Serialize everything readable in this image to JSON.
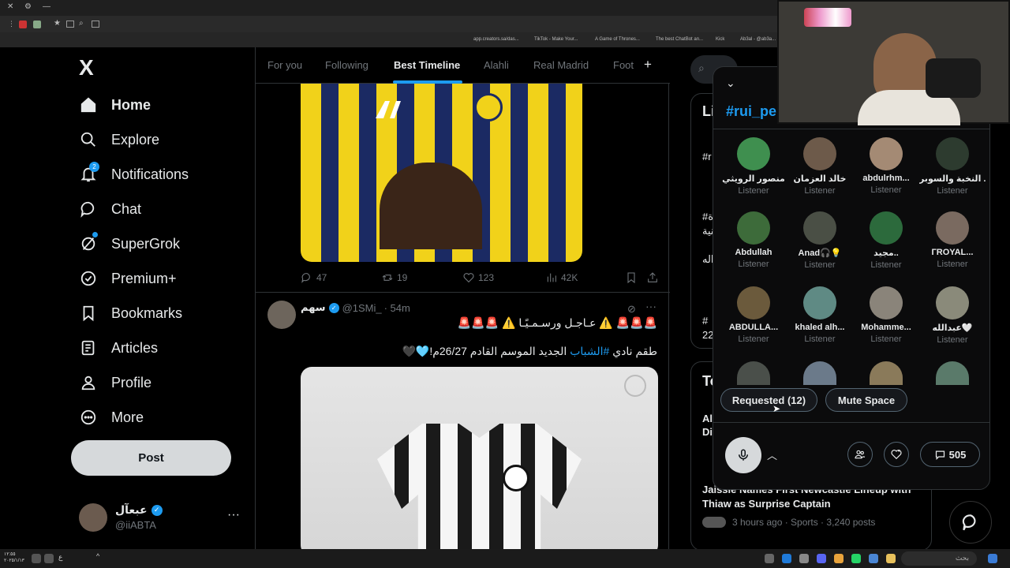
{
  "browser": {
    "bookmarks": [
      "app.creators.sa/das...",
      "TikTok - Make Your...",
      "A Game of Thrones...",
      "The best ChatBot an...",
      "Kick",
      "Ab3al - @ab3a..."
    ]
  },
  "nav": {
    "logo": "X",
    "items": [
      {
        "label": "Home",
        "icon": "home-icon"
      },
      {
        "label": "Explore",
        "icon": "search-icon"
      },
      {
        "label": "Notifications",
        "icon": "bell-icon",
        "badge": "2"
      },
      {
        "label": "Chat",
        "icon": "chat-icon"
      },
      {
        "label": "SuperGrok",
        "icon": "grok-icon"
      },
      {
        "label": "Premium+",
        "icon": "verified-icon"
      },
      {
        "label": "Bookmarks",
        "icon": "bookmark-icon"
      },
      {
        "label": "Articles",
        "icon": "articles-icon"
      },
      {
        "label": "Profile",
        "icon": "person-icon"
      },
      {
        "label": "More",
        "icon": "more-circle-icon"
      }
    ],
    "post_label": "Post",
    "account": {
      "name": "عبعآل",
      "handle": "@iiABTA",
      "more": "···"
    }
  },
  "tabs": [
    "For you",
    "Following",
    "Best Timeline",
    "Alahli",
    "Real Madrid",
    "Foot"
  ],
  "tabs_add": "+",
  "post1": {
    "replies": "47",
    "reposts": "19",
    "likes": "123",
    "views": "42K"
  },
  "post2": {
    "author": "سهم",
    "handle": "@1SMi_",
    "time": "· 54m",
    "line1": "🚨🚨🚨 ⚠️ عـاجـل ورسـمـيًـا ⚠️ 🚨🚨🚨",
    "line2_pre": "طقم نادي ",
    "line2_tag": "#الشباب",
    "line2_post": " الجديد الموسم القادم 26/27م!🩵🖤"
  },
  "right": {
    "live_head": "Li",
    "live_tag": "#rui_pe",
    "trend_head": "To",
    "trend_items": [
      "#r",
      "#ة",
      "نية",
      "راله",
      "#",
      "22"
    ],
    "story1_title_a": "Al-",
    "story1_title_b": "Di",
    "story2_title": "Jaissie Names First Newcastle Lineup with Thiaw as Surprise Captain",
    "story2_meta": "3 hours ago · Sports · 3,240 posts"
  },
  "space": {
    "title": "#rui_pe",
    "listeners": [
      {
        "name": "منصور الرويثي",
        "role": "Listener",
        "color": "#3f8f4f"
      },
      {
        "name": "خالد العزمان",
        "role": "Listener",
        "color": "#6d5a4a"
      },
      {
        "name": "abdulrhm...",
        "role": "Listener",
        "color": "#a48a74"
      },
      {
        "name": "النخبة والسوبر ...",
        "role": "Listener",
        "color": "#2d3b2f"
      },
      {
        "name": "Abdullah",
        "role": "Listener",
        "color": "#3d6b3a"
      },
      {
        "name": "Anad🎧💡",
        "role": "Listener",
        "color": "#4a4f45"
      },
      {
        "name": "مجيد..",
        "role": "Listener",
        "color": "#2c6a3c"
      },
      {
        "name": "ГROYAL...",
        "role": "Listener",
        "color": "#7a6a60"
      },
      {
        "name": "ABDULLA...",
        "role": "Listener",
        "color": "#6b5a3c"
      },
      {
        "name": "khaled alh...",
        "role": "Listener",
        "color": "#5f8a84"
      },
      {
        "name": "Mohamme...",
        "role": "Listener",
        "color": "#8a847a"
      },
      {
        "name": "عبدالله🤍",
        "role": "Listener",
        "color": "#8a8a7a"
      }
    ],
    "requested_label": "Requested (12)",
    "mute_label": "Mute Space",
    "comments": "505"
  },
  "taskbar": {
    "time": "١٢:٥٥",
    "date": "٢٠٢٥/١/١٣",
    "search": "بحث"
  }
}
